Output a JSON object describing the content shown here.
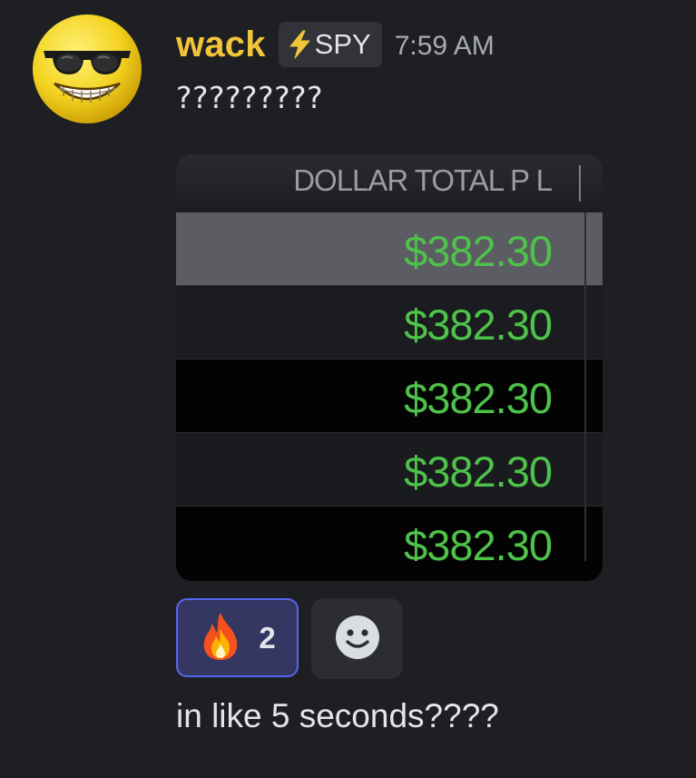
{
  "message": {
    "author": "wack",
    "role_tag": {
      "label": "SPY",
      "icon": "lightning-bolt-icon"
    },
    "timestamp": "7:59 AM",
    "text": "?????????",
    "followup_text": "in like 5 seconds????"
  },
  "attachment": {
    "column_header": "DOLLAR TOTAL P L",
    "rows": [
      "$382.30",
      "$382.30",
      "$382.30",
      "$382.30",
      "$382.30"
    ],
    "value_color": "#4ec24a"
  },
  "reactions": [
    {
      "emoji": "fire-icon",
      "count": "2",
      "active": true
    }
  ],
  "add_reaction_icon": "smiley-face-icon",
  "colors": {
    "username": "#f0c53a",
    "reaction_border": "#5865f2",
    "background": "#1e1f22"
  }
}
